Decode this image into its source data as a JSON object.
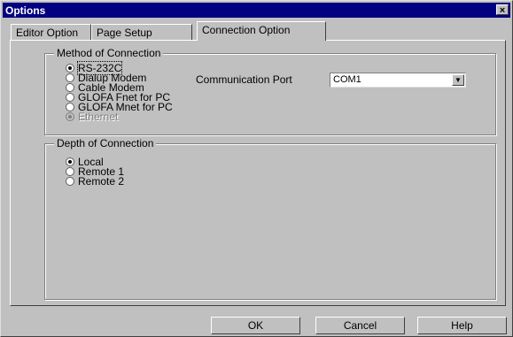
{
  "window": {
    "title": "Options",
    "close_glyph": "×"
  },
  "tabs": [
    {
      "label": "Editor Option",
      "active": false
    },
    {
      "label": "Page Setup",
      "active": false
    },
    {
      "label": "Connection Option",
      "active": true
    }
  ],
  "method_group": {
    "title": "Method of Connection",
    "options": [
      {
        "label": "RS-232C",
        "checked": true,
        "enabled": true
      },
      {
        "label": "Dialup Modem",
        "checked": false,
        "enabled": true
      },
      {
        "label": "Cable Modem",
        "checked": false,
        "enabled": true
      },
      {
        "label": "GLOFA Fnet for PC",
        "checked": false,
        "enabled": true
      },
      {
        "label": "GLOFA Mnet for PC",
        "checked": false,
        "enabled": true
      },
      {
        "label": "Ethernet",
        "checked": true,
        "enabled": false
      }
    ],
    "port_label": "Communication Port",
    "port_value": "COM1",
    "dropdown_glyph": "▼"
  },
  "depth_group": {
    "title": "Depth of Connection",
    "options": [
      {
        "label": "Local",
        "checked": true
      },
      {
        "label": "Remote 1",
        "checked": false
      },
      {
        "label": "Remote 2",
        "checked": false
      }
    ]
  },
  "buttons": {
    "ok": "OK",
    "cancel": "Cancel",
    "help": "Help"
  }
}
